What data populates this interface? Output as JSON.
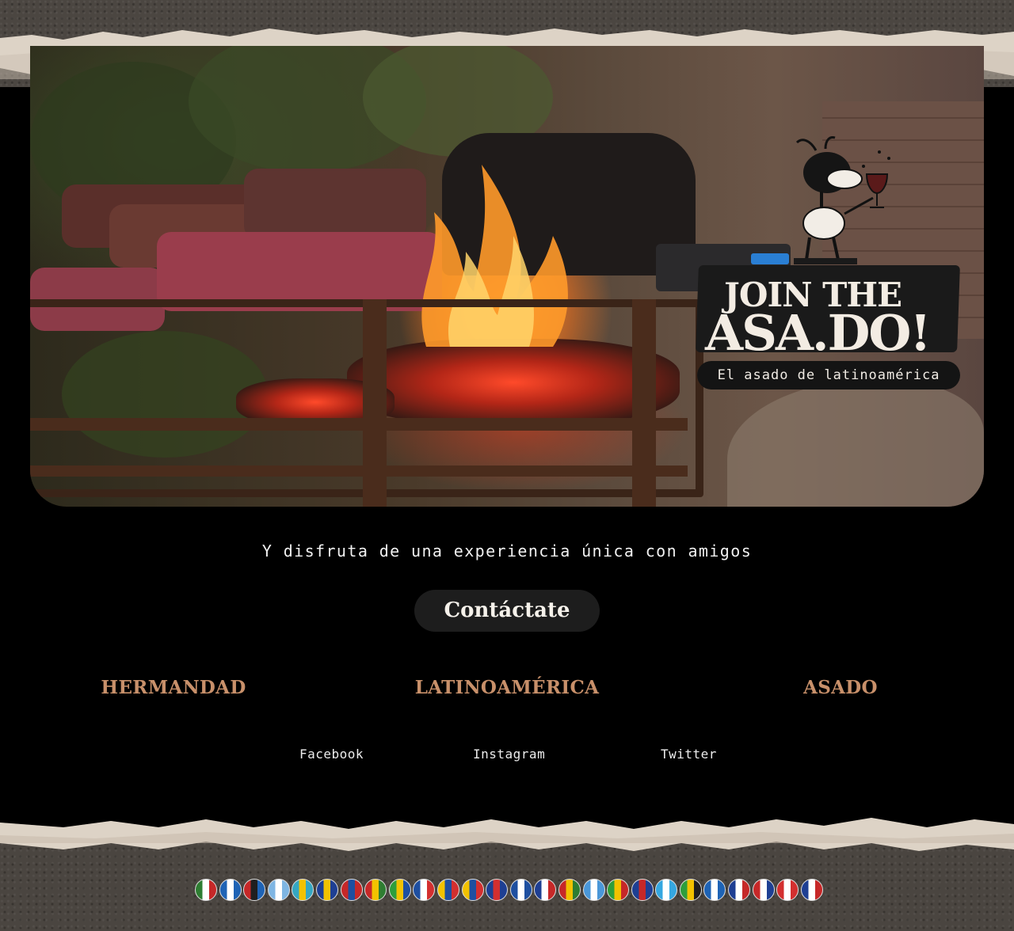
{
  "hero": {
    "logo": {
      "line1": "JOIN THE",
      "line2": "ASA.DO!",
      "subtitle": "El asado de latinoamérica"
    }
  },
  "tagline": "Y disfruta de una experiencia única con amigos",
  "cta": {
    "label": "Contáctate"
  },
  "pillars": [
    "HERMANDAD",
    "LATINOAMÉRICA",
    "ASADO"
  ],
  "social": [
    "Facebook",
    "Instagram",
    "Twitter"
  ],
  "colors": {
    "accent": "#c8906a",
    "background": "#000000",
    "paper": "#ddd3c6",
    "button": "#1d1d1d"
  },
  "flags": [
    {
      "name": "Mexico",
      "colors": [
        "#2e7d32",
        "#ffffff",
        "#c62828"
      ]
    },
    {
      "name": "El Salvador",
      "colors": [
        "#1e63b5",
        "#ffffff",
        "#1e63b5"
      ]
    },
    {
      "name": "Antigua and Barbuda",
      "colors": [
        "#c62828",
        "#1f1f1f",
        "#1e63b5"
      ]
    },
    {
      "name": "Argentina",
      "colors": [
        "#7fb6e3",
        "#ffffff",
        "#7fb6e3"
      ]
    },
    {
      "name": "Bahamas",
      "colors": [
        "#35a7c2",
        "#f2c200",
        "#35a7c2"
      ]
    },
    {
      "name": "Barbados",
      "colors": [
        "#1e3f93",
        "#f2c200",
        "#1e3f93"
      ]
    },
    {
      "name": "Belize",
      "colors": [
        "#c62828",
        "#1e4fa0",
        "#c62828"
      ]
    },
    {
      "name": "Bolivia",
      "colors": [
        "#c62828",
        "#f2c200",
        "#2e7d32"
      ]
    },
    {
      "name": "Brazil",
      "colors": [
        "#2e9e3c",
        "#f2c200",
        "#1e4fa0"
      ]
    },
    {
      "name": "Chile",
      "colors": [
        "#1e4fa0",
        "#ffffff",
        "#d32f2f"
      ]
    },
    {
      "name": "Colombia",
      "colors": [
        "#f2c200",
        "#1e4fa0",
        "#d32f2f"
      ]
    },
    {
      "name": "Ecuador",
      "colors": [
        "#f2c200",
        "#1e4fa0",
        "#d32f2f"
      ]
    },
    {
      "name": "Costa Rica",
      "colors": [
        "#1e3f93",
        "#d32f2f",
        "#1e3f93"
      ]
    },
    {
      "name": "Cuba",
      "colors": [
        "#1e4fa0",
        "#ffffff",
        "#1e4fa0"
      ]
    },
    {
      "name": "Dominican Republic",
      "colors": [
        "#1e3f93",
        "#ffffff",
        "#c62828"
      ]
    },
    {
      "name": "Grenada",
      "colors": [
        "#c62828",
        "#f2c200",
        "#2e7d32"
      ]
    },
    {
      "name": "Guatemala",
      "colors": [
        "#4a97d8",
        "#ffffff",
        "#4a97d8"
      ]
    },
    {
      "name": "Guyana",
      "colors": [
        "#2e9e3c",
        "#f2c200",
        "#c62828"
      ]
    },
    {
      "name": "Haiti",
      "colors": [
        "#1e3f93",
        "#c62828",
        "#1e3f93"
      ]
    },
    {
      "name": "Honduras",
      "colors": [
        "#35a7e0",
        "#ffffff",
        "#35a7e0"
      ]
    },
    {
      "name": "Jamaica",
      "colors": [
        "#2e9e3c",
        "#f2c200",
        "#1f1f1f"
      ]
    },
    {
      "name": "Nicaragua",
      "colors": [
        "#1e63b5",
        "#ffffff",
        "#1e63b5"
      ]
    },
    {
      "name": "Panama",
      "colors": [
        "#1e3f93",
        "#ffffff",
        "#c62828"
      ]
    },
    {
      "name": "Paraguay",
      "colors": [
        "#c62828",
        "#ffffff",
        "#1e3f93"
      ]
    },
    {
      "name": "Peru",
      "colors": [
        "#d32f2f",
        "#ffffff",
        "#d32f2f"
      ]
    },
    {
      "name": "Dominican Republic",
      "colors": [
        "#1e3f93",
        "#ffffff",
        "#c62828"
      ]
    }
  ]
}
